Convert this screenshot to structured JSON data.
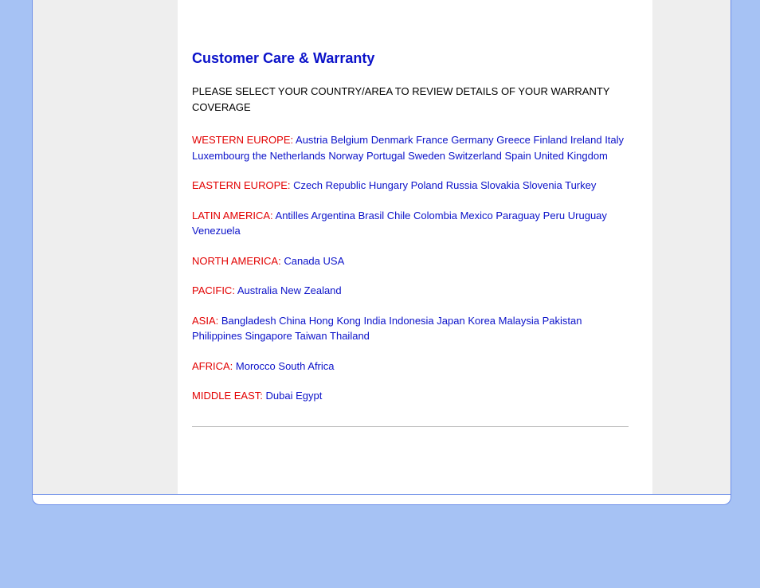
{
  "heading": "Customer Care & Warranty",
  "instructions": "PLEASE SELECT YOUR COUNTRY/AREA TO REVIEW DETAILS OF YOUR WARRANTY COVERAGE",
  "regions": [
    {
      "label": "WESTERN EUROPE:",
      "countries": [
        "Austria",
        "Belgium",
        "Denmark",
        "France",
        "Germany",
        "Greece",
        "Finland",
        "Ireland",
        "Italy",
        "Luxembourg",
        "the Netherlands",
        "Norway",
        "Portugal",
        "Sweden",
        "Switzerland",
        "Spain",
        "United Kingdom"
      ]
    },
    {
      "label": "EASTERN EUROPE:",
      "countries": [
        "Czech Republic",
        "Hungary",
        "Poland",
        "Russia",
        "Slovakia",
        "Slovenia",
        "Turkey"
      ]
    },
    {
      "label": "LATIN AMERICA:",
      "countries": [
        "Antilles",
        "Argentina",
        "Brasil",
        "Chile",
        "Colombia",
        "Mexico",
        "Paraguay",
        "Peru",
        "Uruguay",
        "Venezuela"
      ]
    },
    {
      "label": "NORTH AMERICA:",
      "countries": [
        "Canada",
        "USA"
      ]
    },
    {
      "label": "PACIFIC:",
      "countries": [
        "Australia",
        "New Zealand"
      ]
    },
    {
      "label": "ASIA:",
      "countries": [
        "Bangladesh",
        "China",
        "Hong Kong",
        "India",
        "Indonesia",
        "Japan",
        "Korea",
        "Malaysia",
        "Pakistan",
        "Philippines",
        "Singapore",
        "Taiwan",
        "Thailand"
      ]
    },
    {
      "label": "AFRICA:",
      "countries": [
        "Morocco",
        "South Africa"
      ]
    },
    {
      "label": "MIDDLE EAST:",
      "countries": [
        "Dubai",
        "Egypt"
      ]
    }
  ]
}
